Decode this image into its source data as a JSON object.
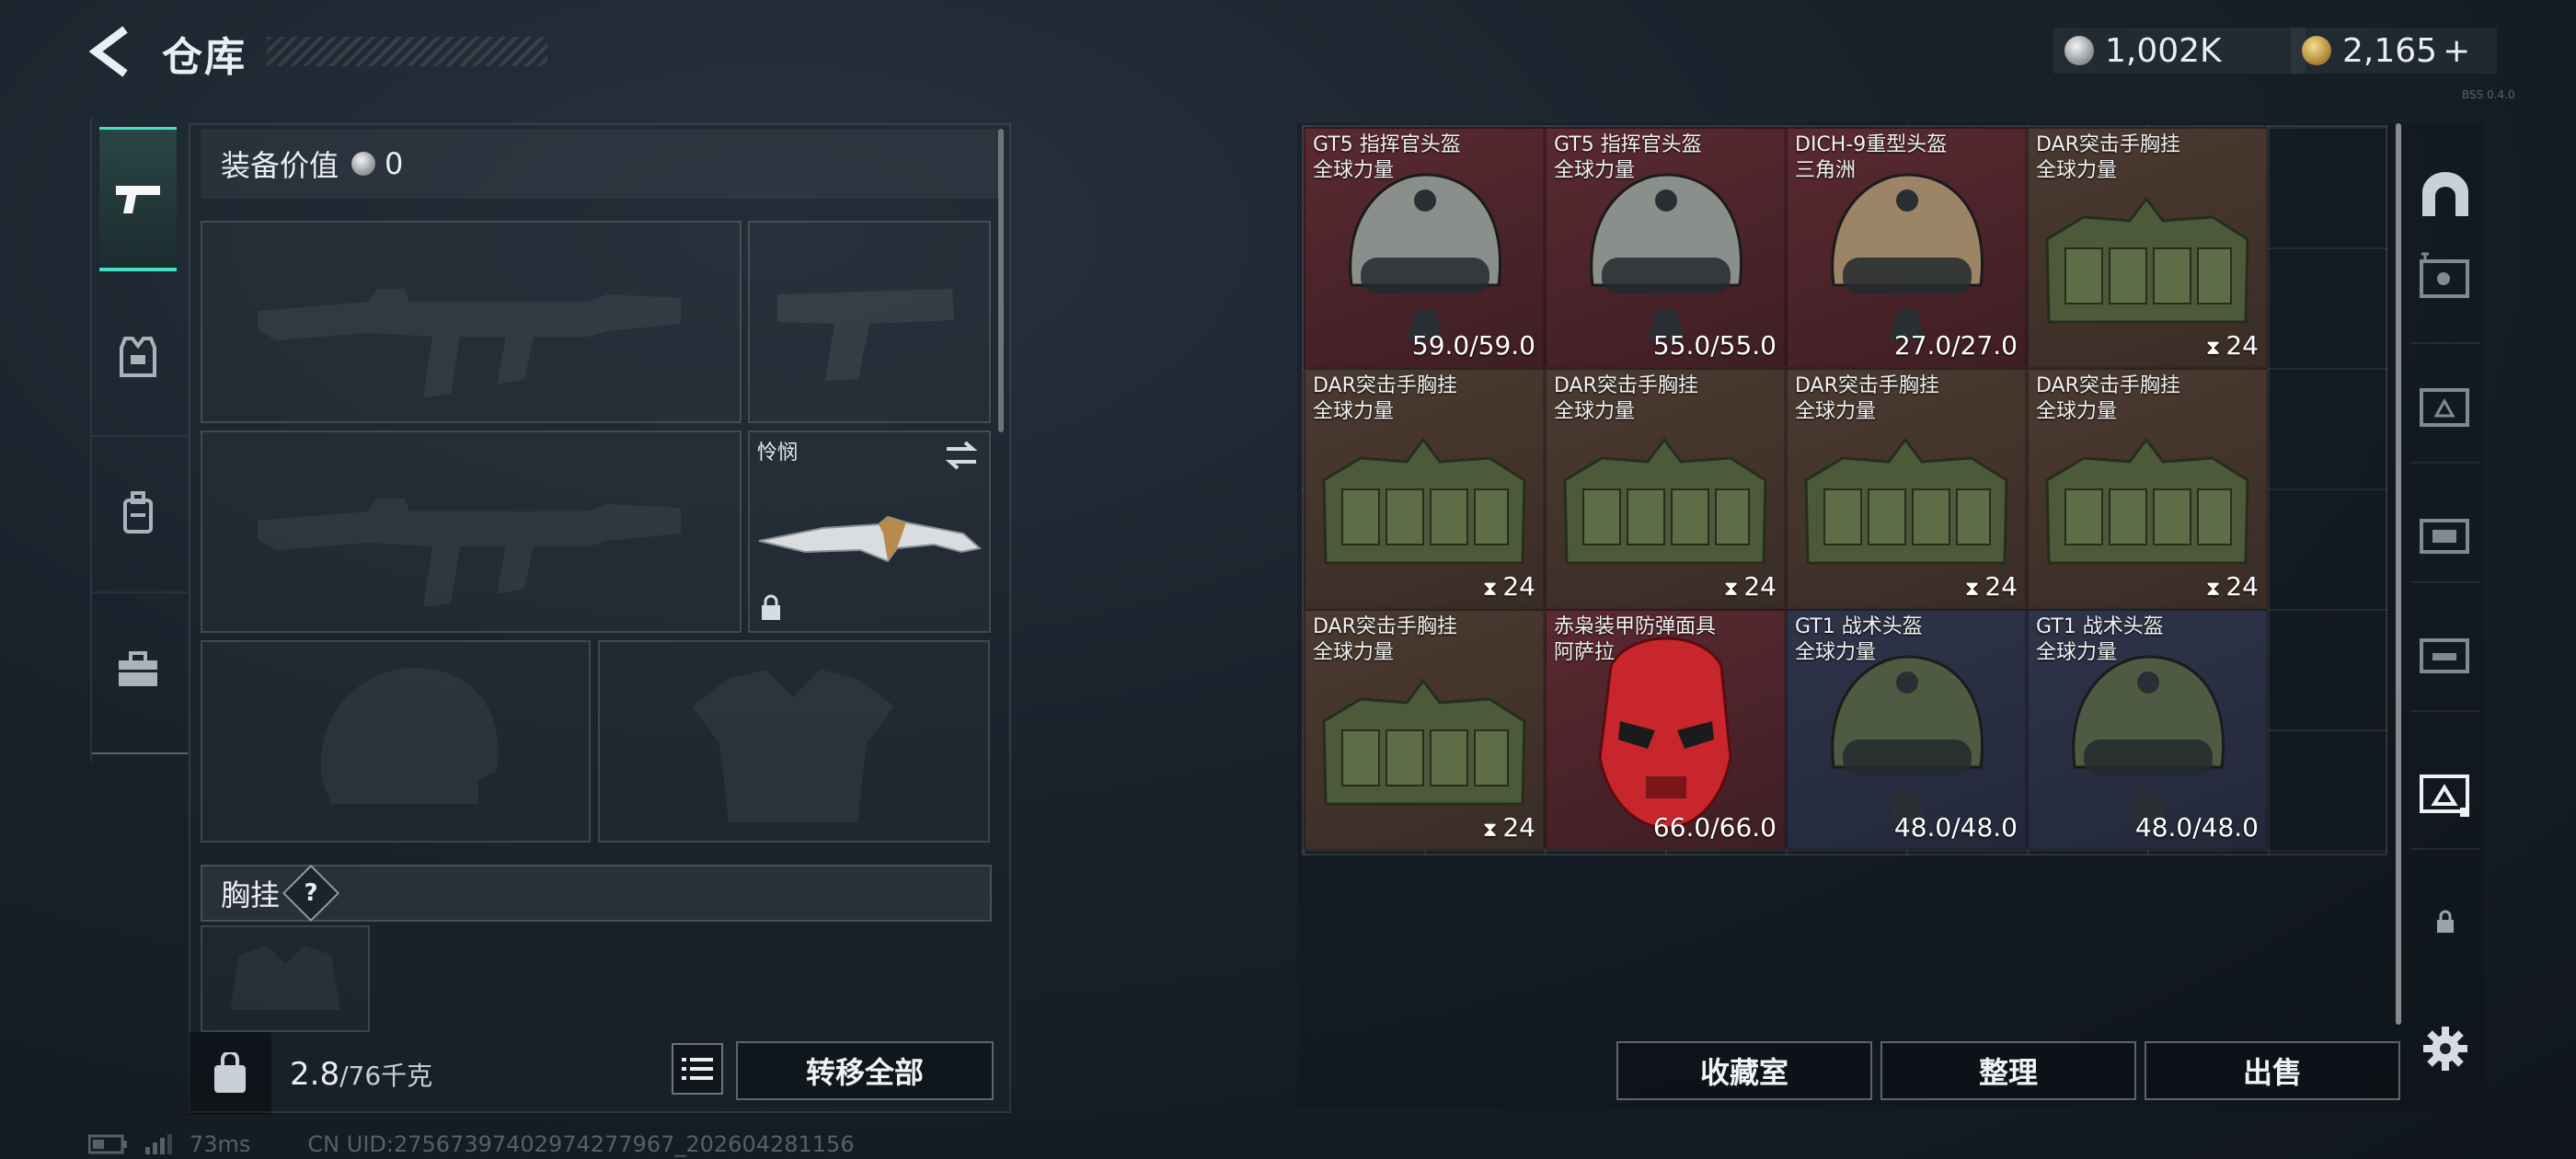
{
  "header": {
    "title": "仓库",
    "currency_silver": "1,002K",
    "currency_gold": "2,165",
    "gold_plus": "+",
    "version": "BSS 0.4.0"
  },
  "equipment": {
    "value_label": "装备价值",
    "value": "0",
    "melee_name": "怜悯",
    "chest_rig_label": "胸挂",
    "help_mark": "?"
  },
  "bottom_left": {
    "weight_current": "2.8",
    "weight_max": "/76千克",
    "transfer_all": "转移全部"
  },
  "status": {
    "ping": "73ms",
    "uid": "CN UID:2756739740297427796​7_202604281156"
  },
  "inventory": {
    "items": [
      {
        "name": "GT5 指挥官头盔",
        "sub": "全球力量",
        "value": "59.0/59.0",
        "kind": "helmet"
      },
      {
        "name": "GT5 指挥官头盔",
        "sub": "全球力量",
        "value": "55.0/55.0",
        "kind": "helmet"
      },
      {
        "name": "DICH-9重型头盔",
        "sub": "三角洲",
        "value": "27.0/27.0",
        "kind": "helmet"
      },
      {
        "name": "DAR突击手胸挂",
        "sub": "全球力量",
        "value": "24",
        "kind": "vest"
      },
      {
        "name": "DAR突击手胸挂",
        "sub": "全球力量",
        "value": "24",
        "kind": "vest"
      },
      {
        "name": "DAR突击手胸挂",
        "sub": "全球力量",
        "value": "24",
        "kind": "vest"
      },
      {
        "name": "DAR突击手胸挂",
        "sub": "全球力量",
        "value": "24",
        "kind": "vest"
      },
      {
        "name": "DAR突击手胸挂",
        "sub": "全球力量",
        "value": "24",
        "kind": "vest"
      },
      {
        "name": "DAR突击手胸挂",
        "sub": "全球力量",
        "value": "24",
        "kind": "vest"
      },
      {
        "name": "赤枭装甲防弹面具",
        "sub": "阿萨拉",
        "value": "66.0/66.0",
        "kind": "mask"
      },
      {
        "name": "GT1 战术头盔",
        "sub": "全球力量",
        "value": "48.0/48.0",
        "kind": "helmet"
      },
      {
        "name": "GT1 战术头盔",
        "sub": "全球力量",
        "value": "48.0/48.0",
        "kind": "helmet"
      }
    ],
    "buttons": {
      "collection": "收藏室",
      "organize": "整理",
      "sell": "出售"
    }
  }
}
